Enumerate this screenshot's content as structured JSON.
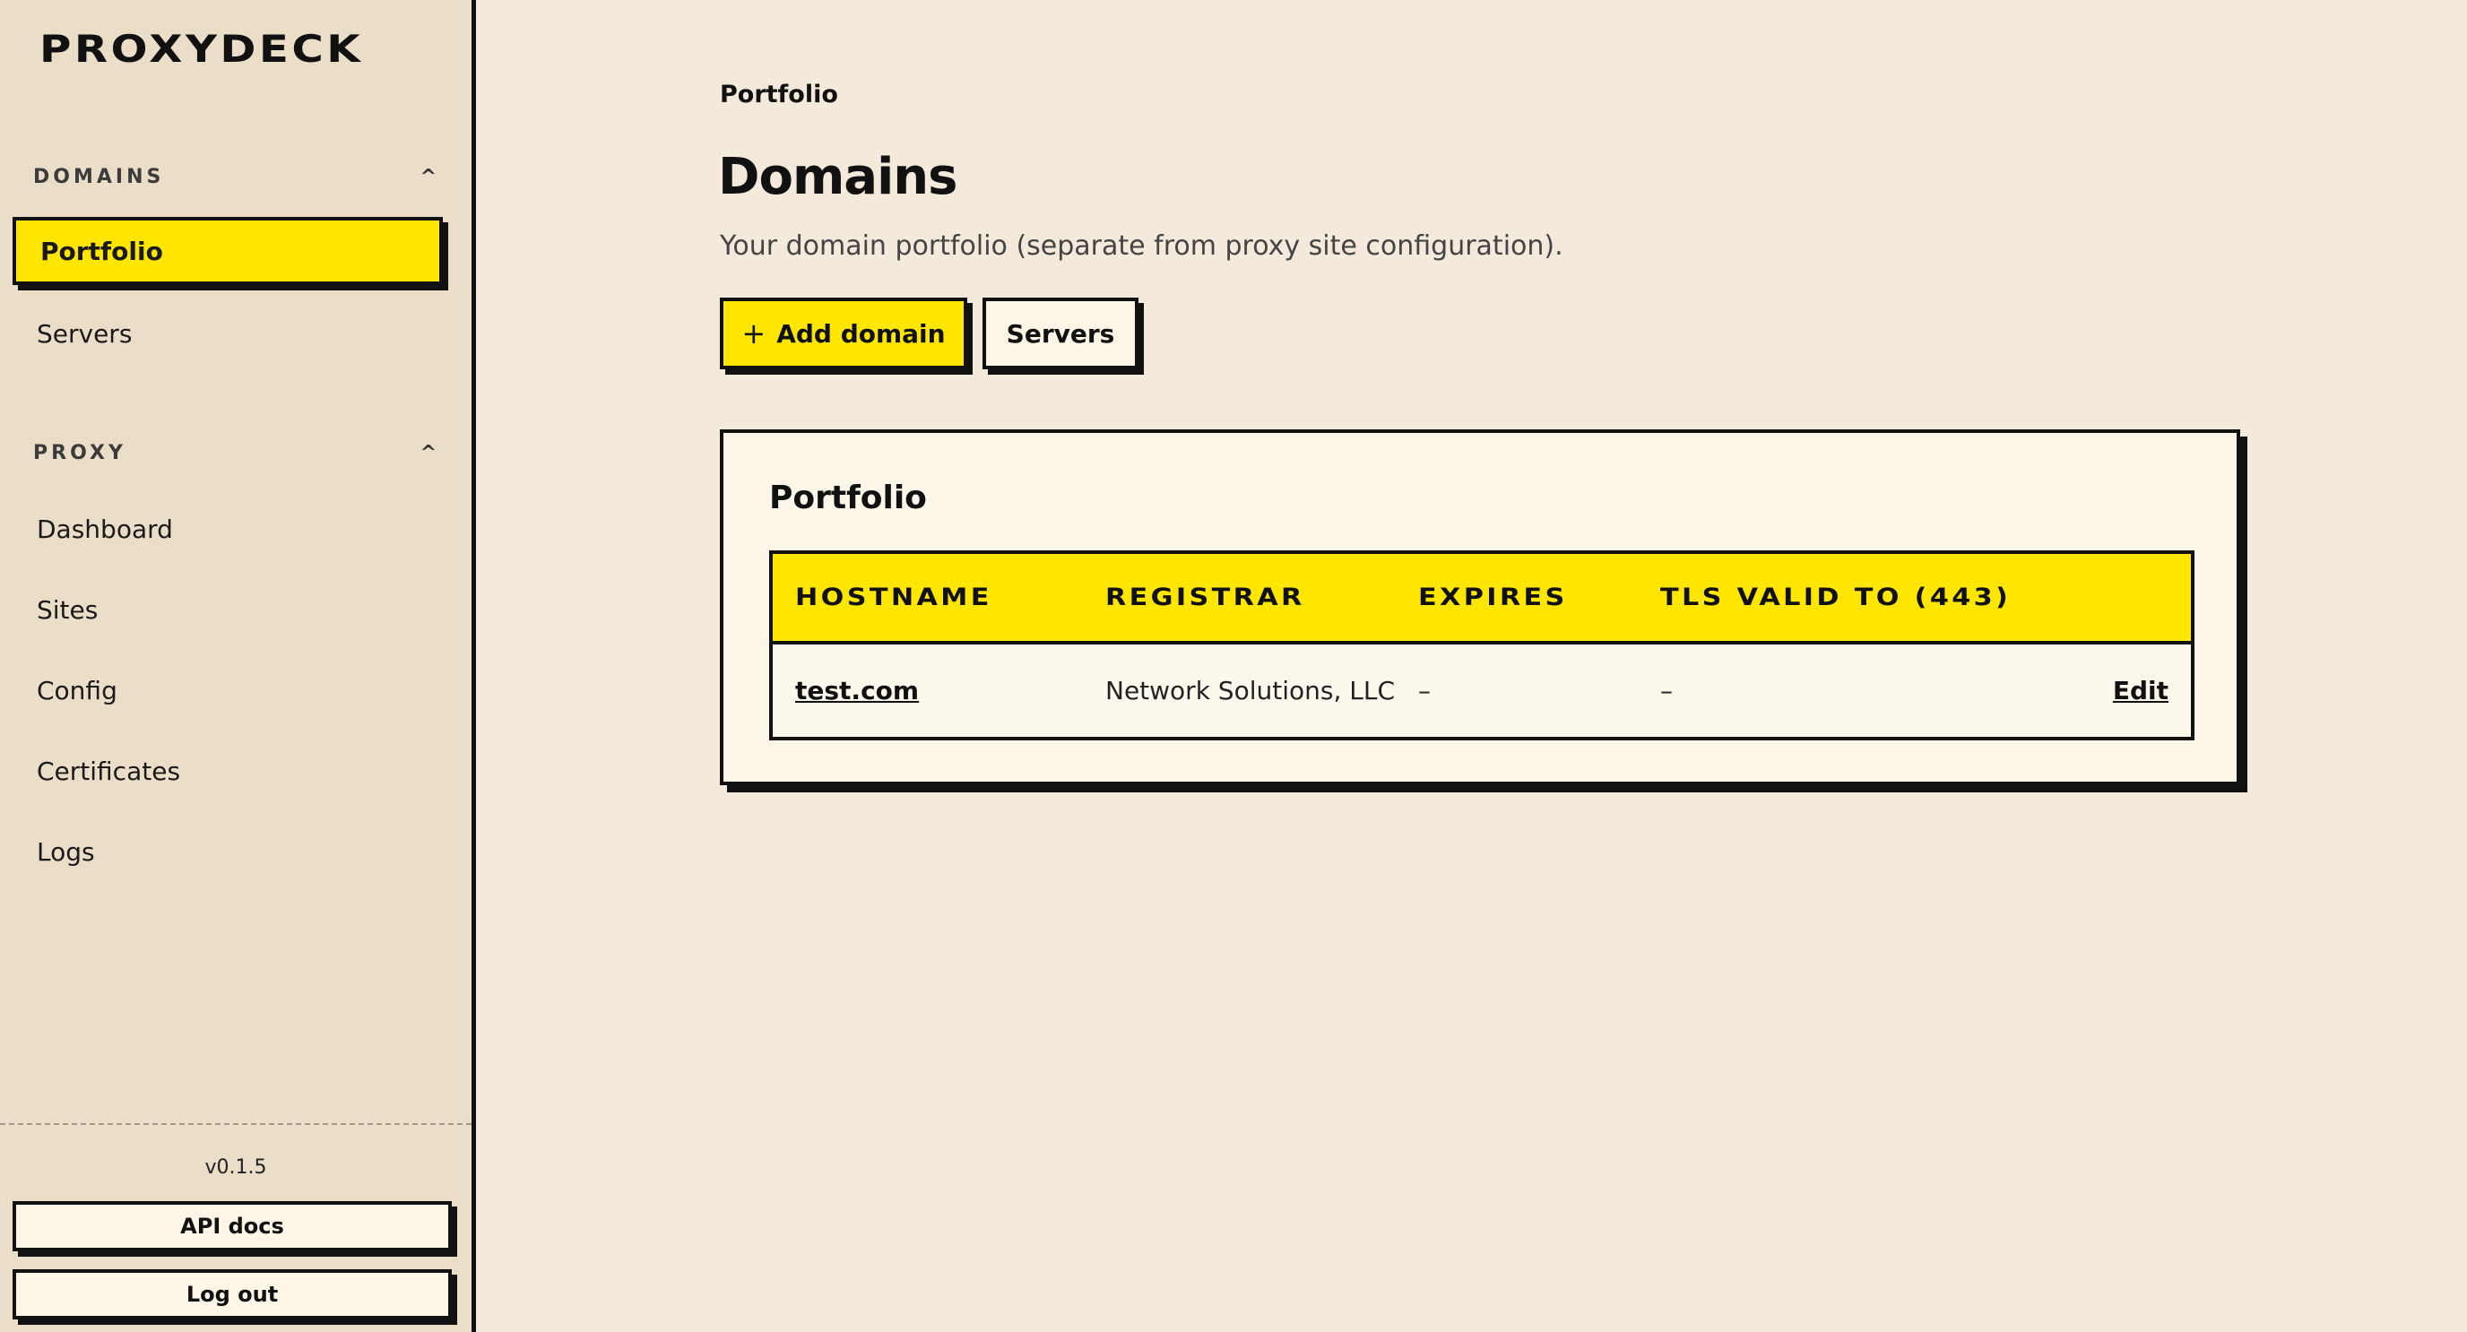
{
  "brand": {
    "logo": "PROXYDECK"
  },
  "sidebar": {
    "sections": [
      {
        "label": "DOMAINS",
        "chevron": "^",
        "items": [
          {
            "label": "Portfolio",
            "active": true
          },
          {
            "label": "Servers"
          }
        ]
      },
      {
        "label": "PROXY",
        "chevron": "^",
        "items": [
          {
            "label": "Dashboard"
          },
          {
            "label": "Sites"
          },
          {
            "label": "Config"
          },
          {
            "label": "Certificates"
          },
          {
            "label": "Logs"
          }
        ]
      }
    ],
    "version": "v0.1.5",
    "api_docs_label": "API docs",
    "logout_label": "Log out"
  },
  "page": {
    "breadcrumb": "Portfolio",
    "title": "Domains",
    "subtitle": "Your domain portfolio (separate from proxy site configuration).",
    "add_button_label": "Add domain",
    "add_button_icon": "plus-icon",
    "servers_button_label": "Servers"
  },
  "portfolio_card": {
    "title": "Portfolio",
    "columns": [
      "HOSTNAME",
      "REGISTRAR",
      "EXPIRES",
      "TLS VALID TO (443)"
    ],
    "rows": [
      {
        "hostname": "test.com",
        "registrar": "Network Solutions, LLC",
        "expires": "–",
        "tls_valid_to": "–",
        "action": "Edit"
      }
    ]
  },
  "colors": {
    "accent": "#ffe600",
    "background": "#f3eadb",
    "sidebar": "#ebdec8",
    "ink": "#111111",
    "card": "#fcf6e8"
  }
}
